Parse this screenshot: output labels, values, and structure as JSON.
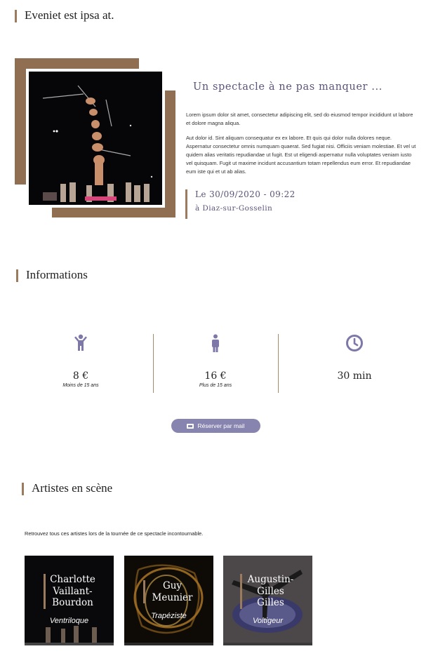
{
  "header": {
    "title": "Eveniet est ipsa at."
  },
  "show": {
    "title": "Un spectacle à ne pas manquer ...",
    "paragraph1": "Lorem ipsum dolor sit amet, consectetur adipiscing elit, sed do eiusmod tempor incididunt ut labore et dolore magna aliqua.",
    "paragraph2": "Aut dolor id. Sint aliquam consequatur ex ex labore. Et quis qui dolor nulla dolores neque. Aspernatur consectetur omnis numquam quaerat. Sed fugiat nisi. Officiis veniam molestiae. Et vel ut quidem alias veritatis repudiandae ut fugit. Est ut eligendi aspernatur nulla voluptates veniam iusto vel quisquam. Fugit ut maxime incidunt accusantium totam repellendus eum error. Et repudiandae eum iste qui et ut ab alias.",
    "date": "Le 30/09/2020 - 09:22",
    "place": "à Diaz-sur-Gosselin"
  },
  "informations": {
    "title": "Informations",
    "items": [
      {
        "icon": "child-icon",
        "value": "8 €",
        "note": "Moins de 15 ans"
      },
      {
        "icon": "adult-icon",
        "value": "16 €",
        "note": "Plus de 15 ans"
      },
      {
        "icon": "clock-icon",
        "value": "30 min",
        "note": ""
      }
    ],
    "reserve_label": "Réserver par mail",
    "reserve_icon": "ticket-icon"
  },
  "artists": {
    "title": "Artistes en scène",
    "intro": "Retrouvez tous ces artistes lors de la tournée de ce spectacle incontournable.",
    "cards": [
      {
        "name": "Charlotte Vaillant-Bourdon",
        "role": "Ventriloque"
      },
      {
        "name": "Guy Meunier",
        "role": "Trapéziste"
      },
      {
        "name": "Augustin-Gilles Gilles",
        "role": "Voltigeur"
      }
    ]
  },
  "colors": {
    "accent": "#5c5478",
    "brown": "#8f6e52",
    "button": "#8884b0"
  }
}
